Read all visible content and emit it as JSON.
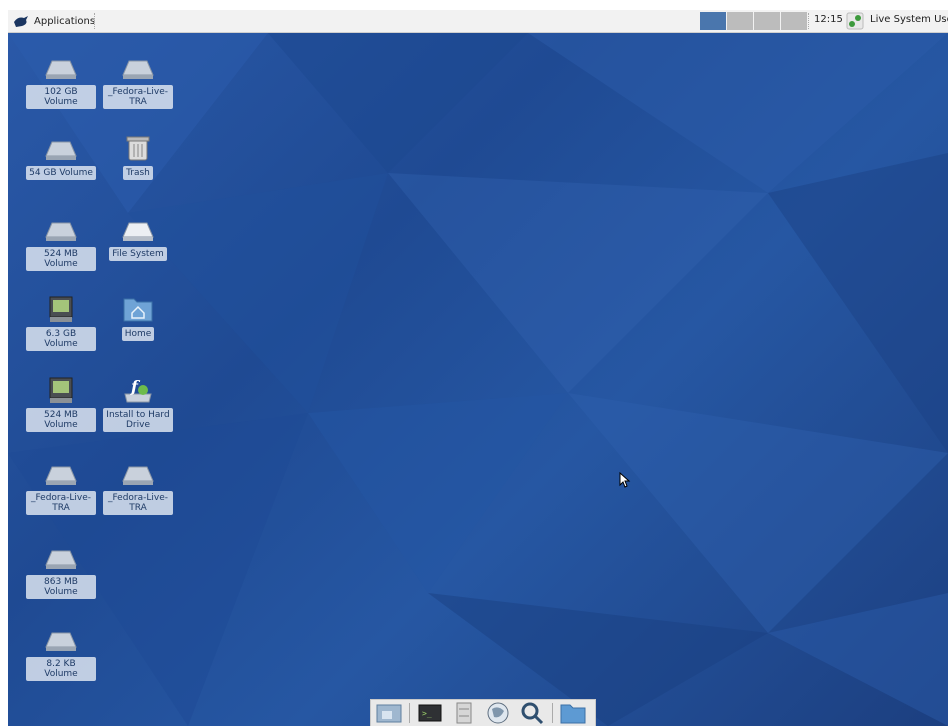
{
  "panel": {
    "applications_label": "Applications",
    "clock": "12:15",
    "user_label": "Live System Use",
    "workspaces": [
      "1",
      "2",
      "3",
      "4"
    ]
  },
  "desktop_icons": [
    {
      "label": "102 GB Volume",
      "icon": "drive-icon"
    },
    {
      "label": "_Fedora-Live-TRA",
      "icon": "drive-icon"
    },
    {
      "label": "54 GB Volume",
      "icon": "drive-icon"
    },
    {
      "label": "Trash",
      "icon": "trash-icon"
    },
    {
      "label": "524 MB Volume",
      "icon": "drive-icon"
    },
    {
      "label": "File System",
      "icon": "drive-icon"
    },
    {
      "label": "6.3 GB Volume",
      "icon": "removable-drive-icon"
    },
    {
      "label": "Home",
      "icon": "home-folder-icon"
    },
    {
      "label": "524 MB Volume",
      "icon": "removable-drive-icon"
    },
    {
      "label": "Install to Hard Drive",
      "icon": "fedora-install-icon"
    },
    {
      "label": "_Fedora-Live-TRA",
      "icon": "drive-icon"
    },
    {
      "label": "_Fedora-Live-TRA",
      "icon": "drive-icon"
    },
    {
      "label": "863 MB Volume",
      "icon": "drive-icon"
    },
    {
      "label": "8.2 KB Volume",
      "icon": "drive-icon"
    }
  ],
  "dock": [
    "show-desktop-icon",
    "terminal-icon",
    "file-manager-icon",
    "web-browser-icon",
    "search-icon",
    "folder-icon"
  ],
  "colors": {
    "panel_bg": "#f2f2f2",
    "desktop_bg": "#2657a3",
    "workspace_active": "#4a76ad",
    "workspace_inactive": "#bcbcbc"
  }
}
